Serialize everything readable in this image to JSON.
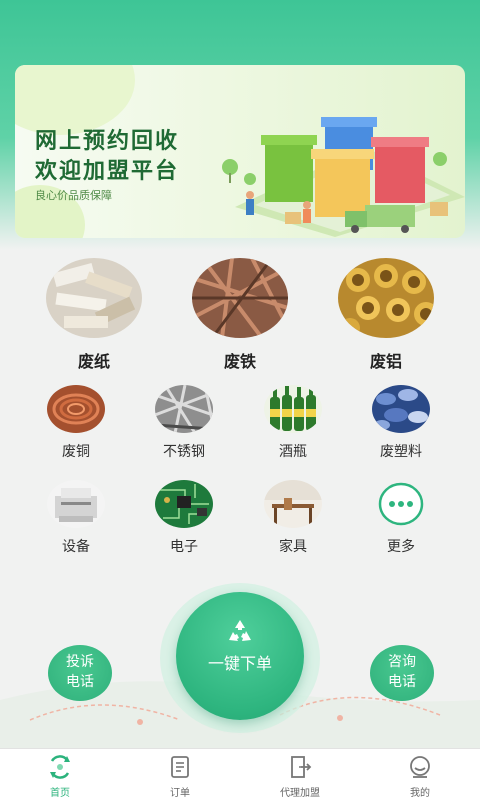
{
  "banner": {
    "title_line1": "网上预约回收",
    "title_line2": "欢迎加盟平台",
    "subtitle": "良心价品质保障"
  },
  "main_categories": [
    {
      "label": "废纸",
      "icon": "waste-paper-photo"
    },
    {
      "label": "废铁",
      "icon": "scrap-iron-photo"
    },
    {
      "label": "废铝",
      "icon": "scrap-aluminum-photo"
    }
  ],
  "categories": [
    {
      "label": "废铜",
      "icon": "copper-wire-photo"
    },
    {
      "label": "不锈钢",
      "icon": "stainless-steel-photo"
    },
    {
      "label": "酒瓶",
      "icon": "beer-bottles-photo"
    },
    {
      "label": "废塑料",
      "icon": "plastic-bottles-photo"
    },
    {
      "label": "设备",
      "icon": "printer-photo"
    },
    {
      "label": "电子",
      "icon": "circuit-board-photo"
    },
    {
      "label": "家具",
      "icon": "furniture-photo"
    },
    {
      "label": "更多",
      "icon": "more-icon"
    }
  ],
  "actions": {
    "order_label": "一键下单",
    "complain_line1": "投诉",
    "complain_line2": "电话",
    "consult_line1": "咨询",
    "consult_line2": "电话"
  },
  "tabbar": [
    {
      "label": "首页",
      "icon": "home-icon",
      "active": true
    },
    {
      "label": "订单",
      "icon": "order-icon",
      "active": false
    },
    {
      "label": "代理加盟",
      "icon": "agent-icon",
      "active": false
    },
    {
      "label": "我的",
      "icon": "profile-icon",
      "active": false
    }
  ],
  "colors": {
    "brand": "#2eb57f",
    "banner_title": "#1f6a34"
  }
}
